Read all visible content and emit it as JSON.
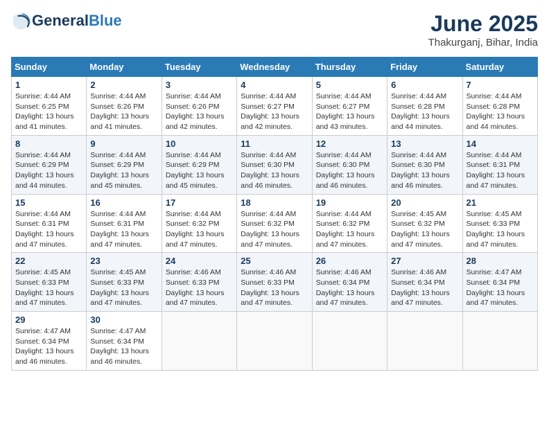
{
  "header": {
    "logo_general": "General",
    "logo_blue": "Blue",
    "month_year": "June 2025",
    "location": "Thakurganj, Bihar, India"
  },
  "days_of_week": [
    "Sunday",
    "Monday",
    "Tuesday",
    "Wednesday",
    "Thursday",
    "Friday",
    "Saturday"
  ],
  "weeks": [
    [
      {
        "day": 1,
        "sunrise": "4:44 AM",
        "sunset": "6:25 PM",
        "daylight": "13 hours and 41 minutes."
      },
      {
        "day": 2,
        "sunrise": "4:44 AM",
        "sunset": "6:26 PM",
        "daylight": "13 hours and 41 minutes."
      },
      {
        "day": 3,
        "sunrise": "4:44 AM",
        "sunset": "6:26 PM",
        "daylight": "13 hours and 42 minutes."
      },
      {
        "day": 4,
        "sunrise": "4:44 AM",
        "sunset": "6:27 PM",
        "daylight": "13 hours and 42 minutes."
      },
      {
        "day": 5,
        "sunrise": "4:44 AM",
        "sunset": "6:27 PM",
        "daylight": "13 hours and 43 minutes."
      },
      {
        "day": 6,
        "sunrise": "4:44 AM",
        "sunset": "6:28 PM",
        "daylight": "13 hours and 44 minutes."
      },
      {
        "day": 7,
        "sunrise": "4:44 AM",
        "sunset": "6:28 PM",
        "daylight": "13 hours and 44 minutes."
      }
    ],
    [
      {
        "day": 8,
        "sunrise": "4:44 AM",
        "sunset": "6:29 PM",
        "daylight": "13 hours and 44 minutes."
      },
      {
        "day": 9,
        "sunrise": "4:44 AM",
        "sunset": "6:29 PM",
        "daylight": "13 hours and 45 minutes."
      },
      {
        "day": 10,
        "sunrise": "4:44 AM",
        "sunset": "6:29 PM",
        "daylight": "13 hours and 45 minutes."
      },
      {
        "day": 11,
        "sunrise": "4:44 AM",
        "sunset": "6:30 PM",
        "daylight": "13 hours and 46 minutes."
      },
      {
        "day": 12,
        "sunrise": "4:44 AM",
        "sunset": "6:30 PM",
        "daylight": "13 hours and 46 minutes."
      },
      {
        "day": 13,
        "sunrise": "4:44 AM",
        "sunset": "6:30 PM",
        "daylight": "13 hours and 46 minutes."
      },
      {
        "day": 14,
        "sunrise": "4:44 AM",
        "sunset": "6:31 PM",
        "daylight": "13 hours and 47 minutes."
      }
    ],
    [
      {
        "day": 15,
        "sunrise": "4:44 AM",
        "sunset": "6:31 PM",
        "daylight": "13 hours and 47 minutes."
      },
      {
        "day": 16,
        "sunrise": "4:44 AM",
        "sunset": "6:31 PM",
        "daylight": "13 hours and 47 minutes."
      },
      {
        "day": 17,
        "sunrise": "4:44 AM",
        "sunset": "6:32 PM",
        "daylight": "13 hours and 47 minutes."
      },
      {
        "day": 18,
        "sunrise": "4:44 AM",
        "sunset": "6:32 PM",
        "daylight": "13 hours and 47 minutes."
      },
      {
        "day": 19,
        "sunrise": "4:44 AM",
        "sunset": "6:32 PM",
        "daylight": "13 hours and 47 minutes."
      },
      {
        "day": 20,
        "sunrise": "4:45 AM",
        "sunset": "6:32 PM",
        "daylight": "13 hours and 47 minutes."
      },
      {
        "day": 21,
        "sunrise": "4:45 AM",
        "sunset": "6:33 PM",
        "daylight": "13 hours and 47 minutes."
      }
    ],
    [
      {
        "day": 22,
        "sunrise": "4:45 AM",
        "sunset": "6:33 PM",
        "daylight": "13 hours and 47 minutes."
      },
      {
        "day": 23,
        "sunrise": "4:45 AM",
        "sunset": "6:33 PM",
        "daylight": "13 hours and 47 minutes."
      },
      {
        "day": 24,
        "sunrise": "4:46 AM",
        "sunset": "6:33 PM",
        "daylight": "13 hours and 47 minutes."
      },
      {
        "day": 25,
        "sunrise": "4:46 AM",
        "sunset": "6:33 PM",
        "daylight": "13 hours and 47 minutes."
      },
      {
        "day": 26,
        "sunrise": "4:46 AM",
        "sunset": "6:34 PM",
        "daylight": "13 hours and 47 minutes."
      },
      {
        "day": 27,
        "sunrise": "4:46 AM",
        "sunset": "6:34 PM",
        "daylight": "13 hours and 47 minutes."
      },
      {
        "day": 28,
        "sunrise": "4:47 AM",
        "sunset": "6:34 PM",
        "daylight": "13 hours and 47 minutes."
      }
    ],
    [
      {
        "day": 29,
        "sunrise": "4:47 AM",
        "sunset": "6:34 PM",
        "daylight": "13 hours and 46 minutes."
      },
      {
        "day": 30,
        "sunrise": "4:47 AM",
        "sunset": "6:34 PM",
        "daylight": "13 hours and 46 minutes."
      },
      null,
      null,
      null,
      null,
      null
    ]
  ]
}
